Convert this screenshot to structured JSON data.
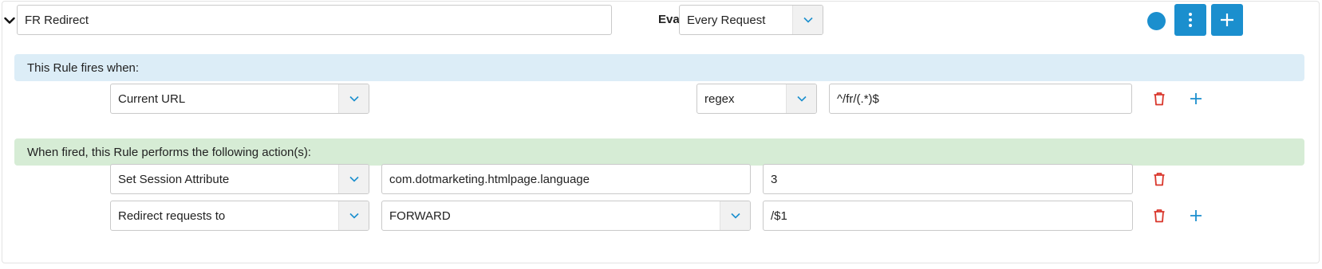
{
  "rule": {
    "name": "FR Redirect",
    "evaluate_label": "Evaluate",
    "evaluate_value": "Every Request"
  },
  "conditions": {
    "banner": "This Rule fires when:",
    "items": [
      {
        "type": "Current URL",
        "comparison": "regex",
        "value": "^/fr/(.*)$"
      }
    ]
  },
  "actions": {
    "banner": "When fired, this Rule performs the following action(s):",
    "items": [
      {
        "type": "Set Session Attribute",
        "param1": "com.dotmarketing.htmlpage.language",
        "param2": "3"
      },
      {
        "type": "Redirect requests to",
        "param1": "FORWARD",
        "param2": "/$1"
      }
    ]
  },
  "colors": {
    "primary": "#1b8fce",
    "danger": "#d9362b",
    "condition_banner": "#dcedf7",
    "action_banner": "#d6ecd5"
  },
  "icons": {
    "collapse": "chevron-down-icon",
    "status": "status-dot-icon",
    "menu": "vertical-dots-icon",
    "add": "plus-icon",
    "delete": "trash-icon"
  }
}
